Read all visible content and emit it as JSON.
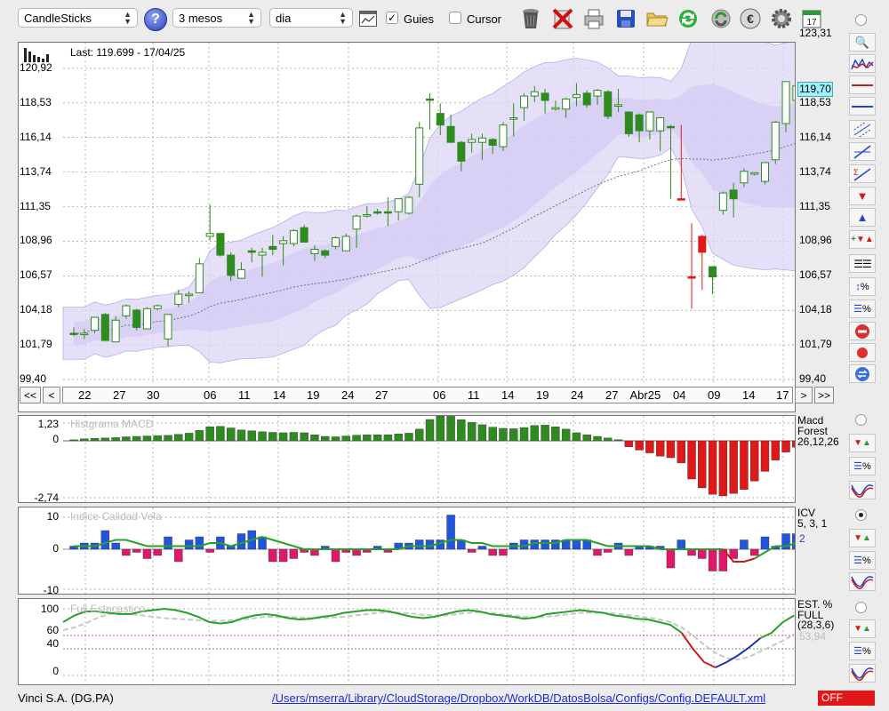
{
  "toolbar": {
    "chart_type": "CandleSticks",
    "period": "3 mesos",
    "interval": "dia",
    "guides_label": "Guies",
    "guides_checked": true,
    "cursor_label": "Cursor",
    "cursor_checked": false
  },
  "main_chart": {
    "last_label": "Last: 119.699 - 17/04/25",
    "current_price": "119,70",
    "y_ticks": [
      "123,31",
      "120,92",
      "118,53",
      "116,14",
      "113,74",
      "111,35",
      "108,96",
      "106,57",
      "104,18",
      "101,79",
      "99,40"
    ],
    "x_labels": [
      "22",
      "27",
      "30",
      "06",
      "11",
      "14",
      "19",
      "24",
      "27",
      "06",
      "11",
      "14",
      "19",
      "24",
      "27",
      "Abr25",
      "04",
      "09",
      "14",
      "17"
    ],
    "nav": {
      "first": "<<",
      "prev": "<",
      "next": ">",
      "last": ">>"
    }
  },
  "macd": {
    "title": "Histgrama MACD",
    "label1": "Macd",
    "label2": "Forest",
    "params": "26,12,26",
    "y_ticks": [
      "1,23",
      "0",
      "-2,74"
    ]
  },
  "icv": {
    "title": "Indice Calidad Vela",
    "label": "ICV",
    "params": "5, 3, 1",
    "value": "2",
    "y_ticks": [
      "10",
      "0",
      "-10"
    ]
  },
  "stoch": {
    "title": "Full Estocastico",
    "label1": "EST. %",
    "label2": "FULL",
    "params": "(28,3,6)",
    "value": "53,94",
    "y_ticks": [
      "100",
      "60",
      "40",
      "0"
    ]
  },
  "status": {
    "ticker": "Vinci S.A. (DG.PA)",
    "path": "/Users/mserra/Library/CloudStorage/Dropbox/WorkDB/DatosBolsa/Configs/Config.DEFAULT.xml",
    "off_label": "OFF"
  },
  "colors": {
    "up": "#2e8b1e",
    "down": "#e01818",
    "blue": "#2255dd",
    "magenta": "#e0186c",
    "band": "#dcd6f5"
  },
  "chart_data": {
    "type": "candlestick",
    "candles": [
      {
        "o": 102.6,
        "h": 103.0,
        "l": 102.4,
        "c": 102.6
      },
      {
        "o": 102.5,
        "h": 102.9,
        "l": 102.2,
        "c": 102.6
      },
      {
        "o": 102.8,
        "h": 103.7,
        "l": 102.6,
        "c": 103.7
      },
      {
        "o": 103.9,
        "h": 104.0,
        "l": 102.2,
        "c": 102.1
      },
      {
        "o": 102.0,
        "h": 103.8,
        "l": 102.0,
        "c": 103.5
      },
      {
        "o": 103.8,
        "h": 104.6,
        "l": 103.6,
        "c": 104.5
      },
      {
        "o": 104.2,
        "h": 104.3,
        "l": 102.8,
        "c": 103.0
      },
      {
        "o": 102.9,
        "h": 104.4,
        "l": 102.9,
        "c": 104.3
      },
      {
        "o": 104.3,
        "h": 104.6,
        "l": 104.2,
        "c": 104.5
      },
      {
        "o": 102.2,
        "h": 103.8,
        "l": 101.7,
        "c": 103.9
      },
      {
        "o": 104.6,
        "h": 105.6,
        "l": 104.4,
        "c": 105.3
      },
      {
        "o": 105.2,
        "h": 105.5,
        "l": 104.7,
        "c": 105.3
      },
      {
        "o": 105.4,
        "h": 107.8,
        "l": 105.4,
        "c": 107.4
      },
      {
        "o": 109.3,
        "h": 111.5,
        "l": 109.0,
        "c": 109.5
      },
      {
        "o": 109.5,
        "h": 109.5,
        "l": 107.9,
        "c": 108.0
      },
      {
        "o": 108.0,
        "h": 108.2,
        "l": 106.2,
        "c": 106.6
      },
      {
        "o": 106.4,
        "h": 107.5,
        "l": 106.4,
        "c": 107.0
      },
      {
        "o": 108.3,
        "h": 108.5,
        "l": 107.5,
        "c": 108.2
      },
      {
        "o": 108.0,
        "h": 108.5,
        "l": 106.5,
        "c": 108.2
      },
      {
        "o": 108.6,
        "h": 109.4,
        "l": 108.0,
        "c": 108.4
      },
      {
        "o": 108.8,
        "h": 109.3,
        "l": 107.3,
        "c": 109.0
      },
      {
        "o": 108.8,
        "h": 109.8,
        "l": 108.6,
        "c": 109.7
      },
      {
        "o": 109.9,
        "h": 110.1,
        "l": 108.9,
        "c": 108.9
      },
      {
        "o": 108.1,
        "h": 108.7,
        "l": 107.6,
        "c": 108.4
      },
      {
        "o": 108.3,
        "h": 108.4,
        "l": 107.8,
        "c": 108.0
      },
      {
        "o": 108.6,
        "h": 109.3,
        "l": 108.4,
        "c": 109.2
      },
      {
        "o": 108.3,
        "h": 109.5,
        "l": 108.3,
        "c": 109.3
      },
      {
        "o": 109.8,
        "h": 110.8,
        "l": 108.5,
        "c": 110.7
      },
      {
        "o": 110.7,
        "h": 111.4,
        "l": 110.6,
        "c": 110.8
      },
      {
        "o": 111.0,
        "h": 111.2,
        "l": 110.8,
        "c": 111.0
      },
      {
        "o": 111.0,
        "h": 112.0,
        "l": 110.0,
        "c": 111.0
      },
      {
        "o": 111.0,
        "h": 111.9,
        "l": 110.4,
        "c": 111.9
      },
      {
        "o": 110.9,
        "h": 112.1,
        "l": 110.8,
        "c": 112.0
      },
      {
        "o": 112.9,
        "h": 117.2,
        "l": 112.0,
        "c": 116.8
      },
      {
        "o": 118.8,
        "h": 119.2,
        "l": 116.7,
        "c": 118.8
      },
      {
        "o": 117.8,
        "h": 118.5,
        "l": 116.3,
        "c": 117.0
      },
      {
        "o": 116.9,
        "h": 117.7,
        "l": 115.9,
        "c": 115.8
      },
      {
        "o": 115.8,
        "h": 115.9,
        "l": 113.8,
        "c": 114.5
      },
      {
        "o": 115.8,
        "h": 116.4,
        "l": 115.1,
        "c": 116.0
      },
      {
        "o": 115.8,
        "h": 116.4,
        "l": 114.6,
        "c": 116.1
      },
      {
        "o": 116.0,
        "h": 116.1,
        "l": 115.0,
        "c": 115.6
      },
      {
        "o": 115.5,
        "h": 117.2,
        "l": 115.2,
        "c": 117.0
      },
      {
        "o": 117.4,
        "h": 118.5,
        "l": 116.2,
        "c": 117.5
      },
      {
        "o": 118.2,
        "h": 119.2,
        "l": 117.3,
        "c": 119.0
      },
      {
        "o": 119.0,
        "h": 119.7,
        "l": 118.6,
        "c": 119.3
      },
      {
        "o": 119.2,
        "h": 119.5,
        "l": 117.8,
        "c": 118.7
      },
      {
        "o": 118.1,
        "h": 118.7,
        "l": 118.0,
        "c": 118.2
      },
      {
        "o": 118.1,
        "h": 118.9,
        "l": 117.5,
        "c": 118.8
      },
      {
        "o": 118.9,
        "h": 119.9,
        "l": 118.3,
        "c": 119.1
      },
      {
        "o": 119.2,
        "h": 119.4,
        "l": 118.2,
        "c": 118.4
      },
      {
        "o": 119.0,
        "h": 119.5,
        "l": 118.4,
        "c": 119.4
      },
      {
        "o": 119.3,
        "h": 119.4,
        "l": 117.4,
        "c": 117.6
      },
      {
        "o": 118.3,
        "h": 119.5,
        "l": 117.9,
        "c": 118.4
      },
      {
        "o": 117.9,
        "h": 117.9,
        "l": 116.2,
        "c": 116.4
      },
      {
        "o": 117.7,
        "h": 117.8,
        "l": 115.8,
        "c": 116.6
      },
      {
        "o": 116.6,
        "h": 117.5,
        "l": 116.0,
        "c": 117.9
      },
      {
        "o": 116.6,
        "h": 116.9,
        "l": 115.2,
        "c": 117.5
      },
      {
        "o": 116.9,
        "h": 117.0,
        "l": 111.9,
        "c": 116.9
      },
      {
        "o": 111.9,
        "h": 117.0,
        "l": 111.9,
        "c": 111.9
      },
      {
        "o": 106.5,
        "h": 110.2,
        "l": 104.3,
        "c": 106.5
      },
      {
        "o": 108.2,
        "h": 109.4,
        "l": 105.6,
        "c": 109.3
      },
      {
        "o": 107.2,
        "h": 107.2,
        "l": 105.3,
        "c": 106.5
      },
      {
        "o": 111.1,
        "h": 112.4,
        "l": 110.8,
        "c": 112.3
      },
      {
        "o": 112.5,
        "h": 113.0,
        "l": 110.6,
        "c": 111.9
      },
      {
        "o": 113.0,
        "h": 114.0,
        "l": 112.7,
        "c": 113.8
      },
      {
        "o": 113.6,
        "h": 113.7,
        "l": 113.5,
        "c": 113.7
      },
      {
        "o": 113.1,
        "h": 114.3,
        "l": 112.9,
        "c": 114.4
      },
      {
        "o": 114.6,
        "h": 117.3,
        "l": 114.3,
        "c": 117.2
      },
      {
        "o": 117.1,
        "h": 120.0,
        "l": 116.5,
        "c": 120.0
      },
      {
        "o": 118.7,
        "h": 119.8,
        "l": 118.5,
        "c": 119.7
      }
    ],
    "macd_hist": [
      0.05,
      0.1,
      0.12,
      0.14,
      0.16,
      0.2,
      0.22,
      0.24,
      0.26,
      0.27,
      0.32,
      0.38,
      0.52,
      0.7,
      0.72,
      0.64,
      0.54,
      0.5,
      0.45,
      0.42,
      0.4,
      0.42,
      0.4,
      0.3,
      0.22,
      0.2,
      0.24,
      0.28,
      0.3,
      0.3,
      0.3,
      0.34,
      0.38,
      0.58,
      1.06,
      1.23,
      1.22,
      1.05,
      0.92,
      0.8,
      0.68,
      0.62,
      0.6,
      0.66,
      0.76,
      0.78,
      0.7,
      0.58,
      0.4,
      0.3,
      0.22,
      0.14,
      0.06,
      -0.3,
      -0.46,
      -0.6,
      -0.76,
      -0.84,
      -1.1,
      -1.9,
      -2.34,
      -2.66,
      -2.74,
      -2.62,
      -2.42,
      -2.0,
      -1.52,
      -0.96,
      -0.56,
      -0.32
    ],
    "icv": [
      1,
      2,
      2,
      6,
      2,
      -2,
      -1,
      -3,
      -2,
      4,
      -4,
      3,
      4,
      -1,
      4,
      1,
      5,
      6,
      4,
      -4,
      -4,
      -3,
      -1,
      -2,
      1,
      -4,
      -1,
      -2,
      -1,
      1,
      -1,
      2,
      2,
      3,
      3,
      3,
      11,
      3,
      -1,
      1,
      -2,
      -2,
      2,
      3,
      3,
      3,
      3,
      3,
      3,
      3,
      -2,
      -1,
      2,
      -2,
      1,
      1,
      1,
      -6,
      3,
      -2,
      -3,
      -7,
      -7,
      -3,
      3,
      -2,
      4,
      1,
      5,
      5,
      4,
      3
    ],
    "icv_line": [
      1,
      1,
      1,
      2,
      3,
      3,
      2,
      1,
      1,
      1,
      1,
      1,
      1,
      2,
      2,
      1,
      2,
      3,
      4,
      3,
      2,
      1,
      0,
      0,
      0,
      0,
      0,
      0,
      0,
      0,
      0,
      0,
      1,
      1,
      1,
      2,
      3,
      3,
      2,
      2,
      1,
      1,
      1,
      1,
      2,
      2,
      2,
      3,
      3,
      3,
      2,
      1,
      1,
      1,
      1,
      1,
      0,
      0,
      0,
      0,
      0,
      0,
      0,
      -4,
      -4,
      -3,
      -1,
      1,
      1,
      2,
      3,
      3
    ],
    "stoch_k": [
      80,
      90,
      96,
      96,
      94,
      92,
      92,
      96,
      98,
      100,
      98,
      94,
      88,
      80,
      78,
      80,
      86,
      90,
      92,
      90,
      86,
      84,
      85,
      88,
      90,
      94,
      96,
      98,
      98,
      96,
      92,
      88,
      86,
      88,
      92,
      96,
      98,
      96,
      92,
      90,
      88,
      85,
      87,
      92,
      94,
      96,
      98,
      96,
      94,
      90,
      88,
      85,
      84,
      80,
      76,
      64,
      40,
      20,
      12,
      20,
      30,
      42,
      56,
      64,
      80,
      90
    ],
    "stoch_d": [
      68,
      72,
      78,
      86,
      92,
      94,
      92,
      90,
      88,
      86,
      85,
      84,
      83,
      82,
      82,
      83,
      84,
      86,
      88,
      88,
      88,
      87,
      86,
      86,
      87,
      88,
      90,
      92,
      94,
      95,
      94,
      93,
      91,
      90,
      90,
      92,
      94,
      95,
      94,
      92,
      90,
      88,
      87,
      88,
      90,
      92,
      94,
      94,
      94,
      93,
      91,
      89,
      87,
      84,
      80,
      72,
      60,
      46,
      34,
      26,
      24,
      28,
      36,
      44,
      52,
      62
    ]
  }
}
